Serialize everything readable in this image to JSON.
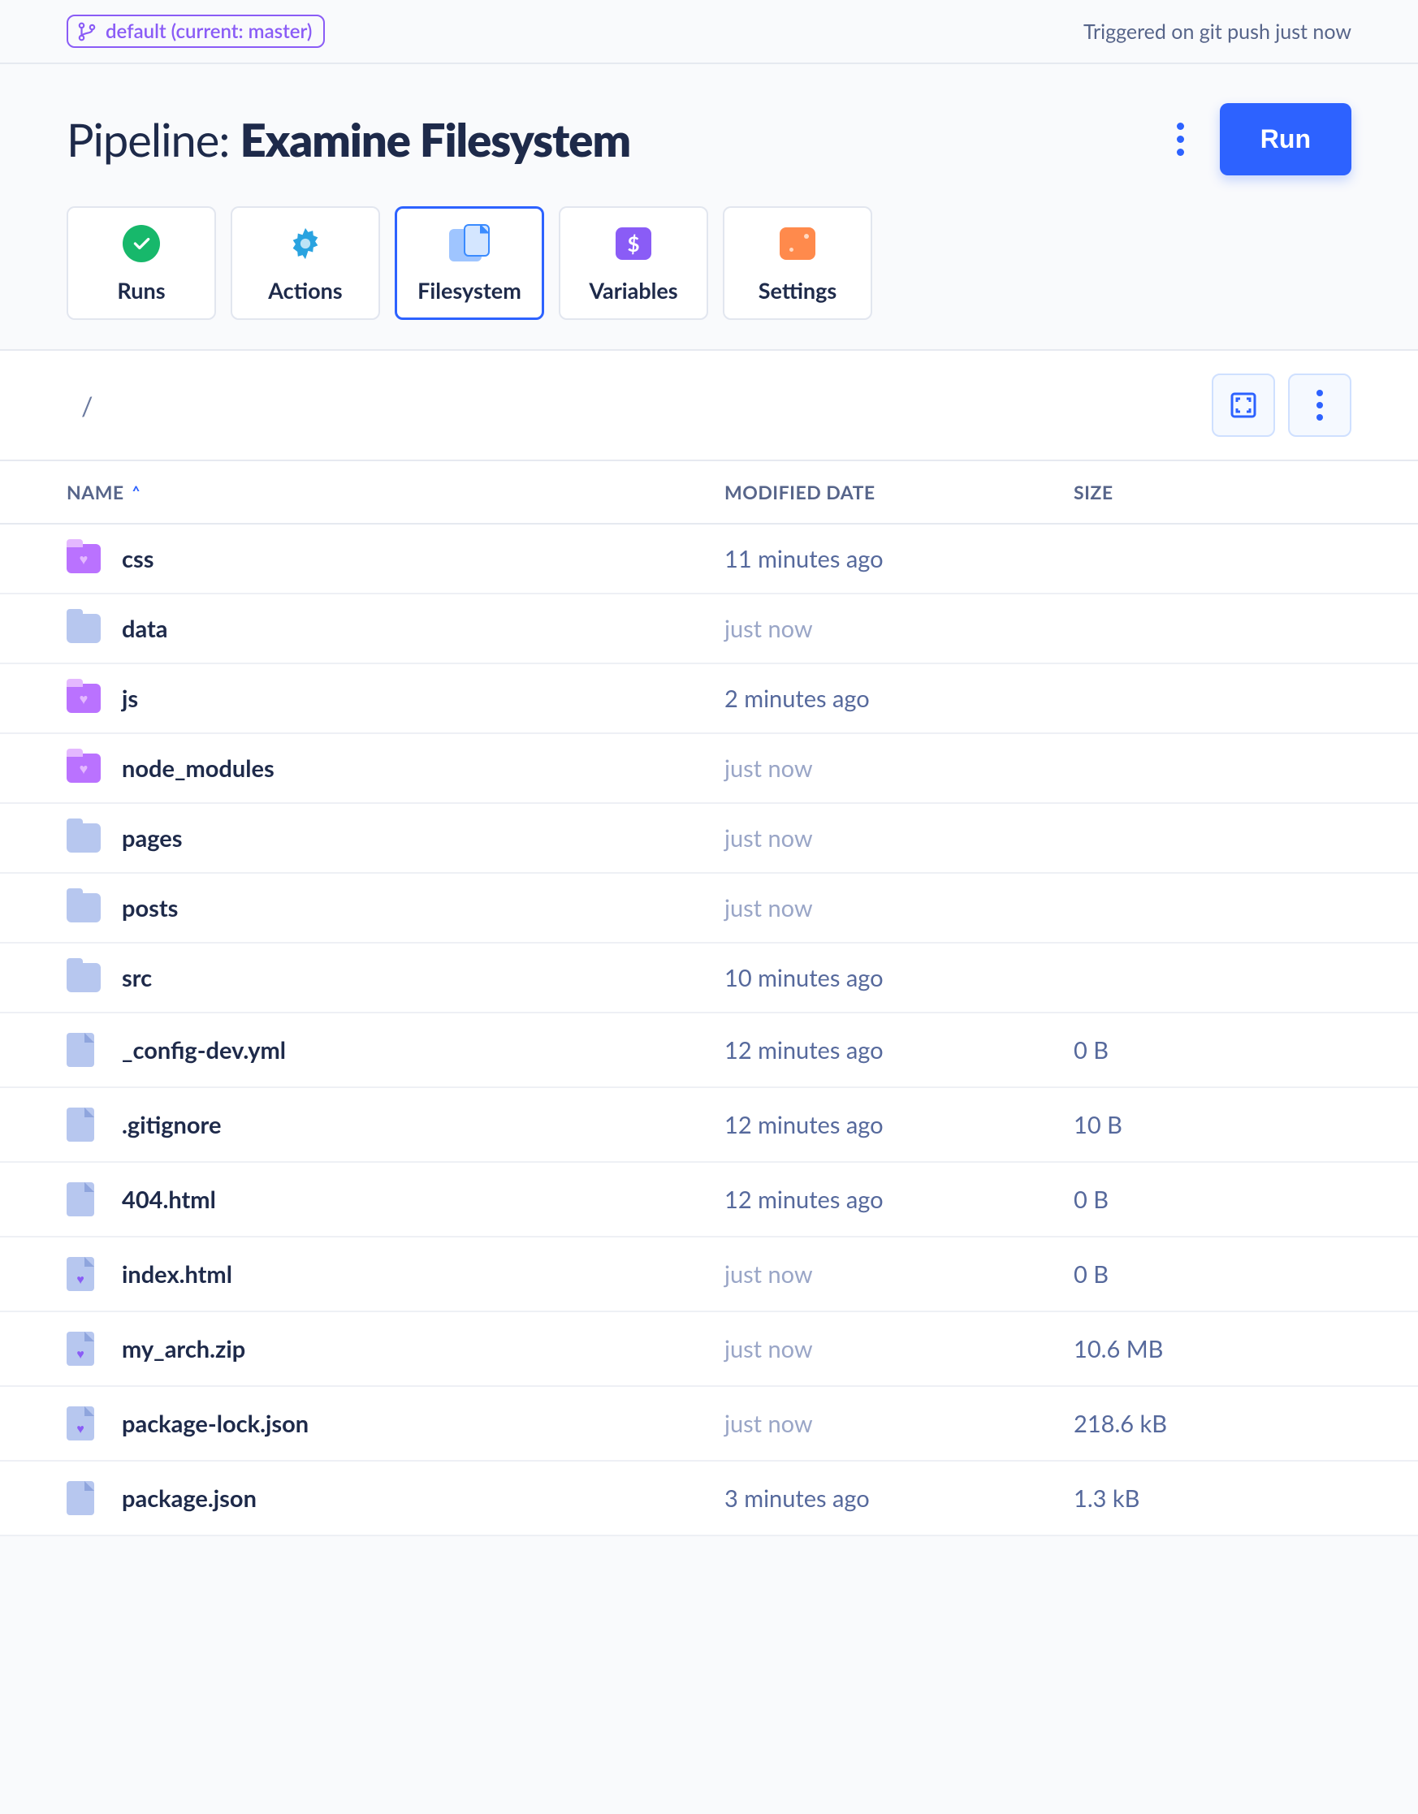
{
  "topbar": {
    "branch_label": "default (current: master)",
    "trigger_text": "Triggered on git push just now"
  },
  "header": {
    "title_prefix": "Pipeline: ",
    "title_bold": "Examine Filesystem",
    "run_label": "Run"
  },
  "tabs": [
    {
      "id": "runs",
      "label": "Runs",
      "icon": "check-circle-icon",
      "active": false
    },
    {
      "id": "actions",
      "label": "Actions",
      "icon": "gear-badge-icon",
      "active": false
    },
    {
      "id": "filesystem",
      "label": "Filesystem",
      "icon": "filesystem-icon",
      "active": true
    },
    {
      "id": "variables",
      "label": "Variables",
      "icon": "dollar-box-icon",
      "active": false
    },
    {
      "id": "settings",
      "label": "Settings",
      "icon": "settings-box-icon",
      "active": false
    }
  ],
  "pathbar": {
    "breadcrumb": "/"
  },
  "columns": {
    "name": "NAME",
    "modified": "MODIFIED DATE",
    "size": "SIZE",
    "sort_col": "name",
    "sort_dir": "asc"
  },
  "rows": [
    {
      "kind": "folder-purple",
      "name": "css",
      "modified": "11 minutes ago",
      "modified_muted": false,
      "size": ""
    },
    {
      "kind": "folder-blue",
      "name": "data",
      "modified": "just now",
      "modified_muted": true,
      "size": ""
    },
    {
      "kind": "folder-purple",
      "name": "js",
      "modified": "2 minutes ago",
      "modified_muted": false,
      "size": ""
    },
    {
      "kind": "folder-purple",
      "name": "node_modules",
      "modified": "just now",
      "modified_muted": true,
      "size": ""
    },
    {
      "kind": "folder-blue",
      "name": "pages",
      "modified": "just now",
      "modified_muted": true,
      "size": ""
    },
    {
      "kind": "folder-blue",
      "name": "posts",
      "modified": "just now",
      "modified_muted": true,
      "size": ""
    },
    {
      "kind": "folder-blue",
      "name": "src",
      "modified": "10 minutes ago",
      "modified_muted": false,
      "size": ""
    },
    {
      "kind": "file-blue",
      "name": "_config-dev.yml",
      "modified": "12 minutes ago",
      "modified_muted": false,
      "size": "0 B"
    },
    {
      "kind": "file-blue",
      "name": ".gitignore",
      "modified": "12 minutes ago",
      "modified_muted": false,
      "size": "10 B"
    },
    {
      "kind": "file-blue",
      "name": "404.html",
      "modified": "12 minutes ago",
      "modified_muted": false,
      "size": "0 B"
    },
    {
      "kind": "file-heart",
      "name": "index.html",
      "modified": "just now",
      "modified_muted": true,
      "size": "0 B"
    },
    {
      "kind": "file-heart",
      "name": "my_arch.zip",
      "modified": "just now",
      "modified_muted": true,
      "size": "10.6 MB"
    },
    {
      "kind": "file-heart",
      "name": "package-lock.json",
      "modified": "just now",
      "modified_muted": true,
      "size": "218.6 kB"
    },
    {
      "kind": "file-blue",
      "name": "package.json",
      "modified": "3 minutes ago",
      "modified_muted": false,
      "size": "1.3 kB"
    }
  ]
}
